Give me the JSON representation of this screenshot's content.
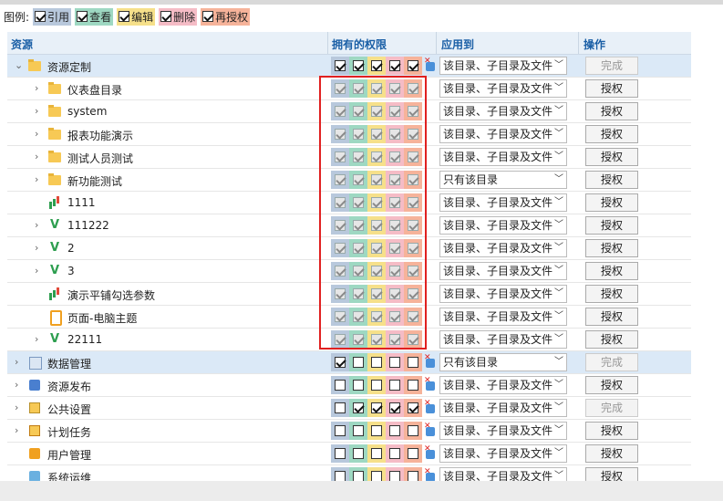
{
  "legend": {
    "label": "图例:",
    "items": [
      {
        "name": "引用",
        "color": "#b8c8dc"
      },
      {
        "name": "查看",
        "color": "#9ed8c2"
      },
      {
        "name": "编辑",
        "color": "#f6e08a"
      },
      {
        "name": "删除",
        "color": "#f5bcc6"
      },
      {
        "name": "再授权",
        "color": "#f6b39a"
      }
    ]
  },
  "header": {
    "resource": "资源",
    "perms": "拥有的权限",
    "apply": "应用到",
    "action": "操作"
  },
  "options": {
    "all": "该目录、子目录及文件",
    "dir": "只有该目录"
  },
  "buttons": {
    "grant": "授权",
    "done": "完成"
  },
  "rows": [
    {
      "label": "资源定制",
      "icon": "folder",
      "perms": [
        1,
        1,
        1,
        1,
        1
      ],
      "apply": "该目录、子目录及文件",
      "btn": "完成",
      "disabled": false,
      "sel": true
    },
    {
      "label": "仪表盘目录",
      "icon": "folder",
      "perms": [
        1,
        1,
        1,
        1,
        1
      ],
      "apply": "该目录、子目录及文件",
      "btn": "授权",
      "disabled": true
    },
    {
      "label": "system",
      "icon": "folder",
      "perms": [
        1,
        1,
        1,
        1,
        1
      ],
      "apply": "该目录、子目录及文件",
      "btn": "授权",
      "disabled": true
    },
    {
      "label": "报表功能演示",
      "icon": "folder",
      "perms": [
        1,
        1,
        1,
        1,
        1
      ],
      "apply": "该目录、子目录及文件",
      "btn": "授权",
      "disabled": true
    },
    {
      "label": "测试人员测试",
      "icon": "folder",
      "perms": [
        1,
        1,
        1,
        1,
        1
      ],
      "apply": "该目录、子目录及文件",
      "btn": "授权",
      "disabled": true
    },
    {
      "label": "新功能测试",
      "icon": "folder",
      "perms": [
        1,
        1,
        1,
        1,
        1
      ],
      "apply": "只有该目录",
      "btn": "授权",
      "disabled": true
    },
    {
      "label": "1111",
      "icon": "chart",
      "perms": [
        1,
        1,
        1,
        1,
        1
      ],
      "apply": "该目录、子目录及文件",
      "btn": "授权",
      "disabled": true
    },
    {
      "label": "111222",
      "icon": "viz",
      "perms": [
        1,
        1,
        1,
        1,
        1
      ],
      "apply": "该目录、子目录及文件",
      "btn": "授权",
      "disabled": true
    },
    {
      "label": "2",
      "icon": "viz",
      "perms": [
        1,
        1,
        1,
        1,
        1
      ],
      "apply": "该目录、子目录及文件",
      "btn": "授权",
      "disabled": true
    },
    {
      "label": "3",
      "icon": "viz",
      "perms": [
        1,
        1,
        1,
        1,
        1
      ],
      "apply": "该目录、子目录及文件",
      "btn": "授权",
      "disabled": true
    },
    {
      "label": "演示平铺勾选参数",
      "icon": "chart",
      "perms": [
        1,
        1,
        1,
        1,
        1
      ],
      "apply": "该目录、子目录及文件",
      "btn": "授权",
      "disabled": true
    },
    {
      "label": "页面-电脑主题",
      "icon": "page",
      "perms": [
        1,
        1,
        1,
        1,
        1
      ],
      "apply": "该目录、子目录及文件",
      "btn": "授权",
      "disabled": true
    },
    {
      "label": "22111",
      "icon": "viz",
      "perms": [
        1,
        1,
        1,
        1,
        1
      ],
      "apply": "该目录、子目录及文件",
      "btn": "授权",
      "disabled": true
    },
    {
      "label": "数据管理",
      "icon": "mgmt",
      "perms": [
        1,
        0,
        0,
        0,
        0
      ],
      "apply": "只有该目录",
      "btn": "完成",
      "disabled": false,
      "sel": true
    },
    {
      "label": "资源发布",
      "icon": "pub",
      "perms": [
        0,
        0,
        0,
        0,
        0
      ],
      "apply": "该目录、子目录及文件",
      "btn": "授权",
      "disabled": false
    },
    {
      "label": "公共设置",
      "icon": "gear",
      "perms": [
        0,
        1,
        1,
        1,
        1
      ],
      "apply": "该目录、子目录及文件",
      "btn": "完成",
      "disabled": false
    },
    {
      "label": "计划任务",
      "icon": "task",
      "perms": [
        0,
        0,
        0,
        0,
        0
      ],
      "apply": "该目录、子目录及文件",
      "btn": "授权",
      "disabled": false
    },
    {
      "label": "用户管理",
      "icon": "user",
      "perms": [
        0,
        0,
        0,
        0,
        0
      ],
      "apply": "该目录、子目录及文件",
      "btn": "授权",
      "disabled": false
    },
    {
      "label": "系统运维",
      "icon": "sys",
      "perms": [
        0,
        0,
        0,
        0,
        0
      ],
      "apply": "该目录、子目录及文件",
      "btn": "授权",
      "disabled": false
    }
  ]
}
